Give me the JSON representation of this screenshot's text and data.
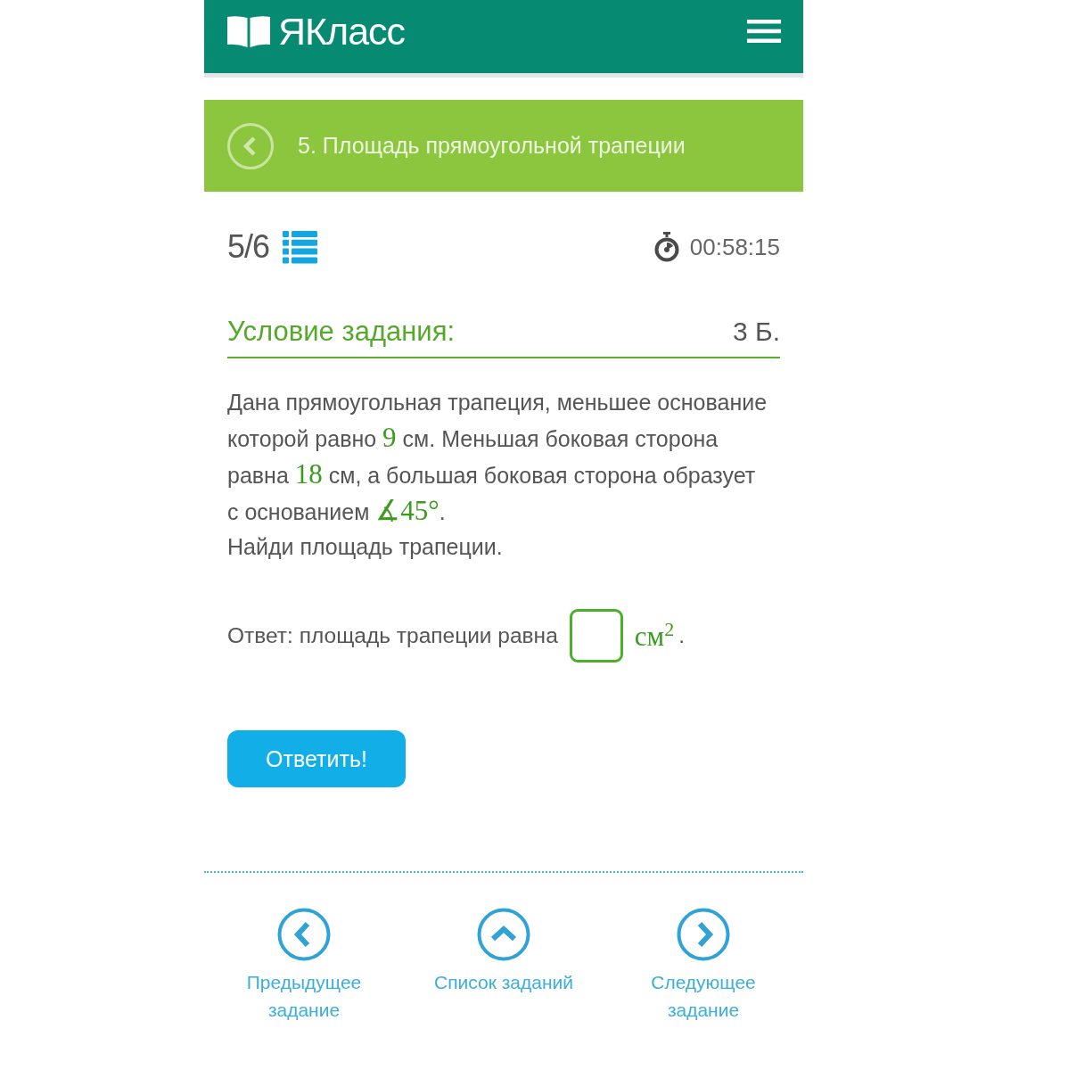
{
  "header": {
    "logo_text": "ЯКласс"
  },
  "topic_bar": {
    "title": "5. Площадь прямоугольной трапеции"
  },
  "progress": {
    "counter": "5/6",
    "timer": "00:58:15"
  },
  "task": {
    "heading": "Условие задания:",
    "points": "3 Б.",
    "problem": [
      {
        "kind": "text",
        "text": "Дана прямоугольная трапеция, меньшее основание которой равно "
      },
      {
        "kind": "math",
        "text": "9"
      },
      {
        "kind": "text",
        "text": " см. Меньшая боковая сторона равна "
      },
      {
        "kind": "math",
        "text": "18"
      },
      {
        "kind": "text",
        "text": " см, а большая боковая сторона образует с основанием "
      },
      {
        "kind": "math",
        "text": "∡45°"
      },
      {
        "kind": "text",
        "text": "."
      }
    ],
    "question": "Найди площадь трапеции.",
    "answer": [
      {
        "kind": "text",
        "text": "Ответ: площадь трапеции равна"
      },
      {
        "kind": "field"
      },
      {
        "kind": "math",
        "text": "см$^{2}$"
      },
      {
        "kind": "text",
        "text": "."
      }
    ]
  },
  "submit_button": "Ответить!",
  "nav": [
    {
      "kind": "previous",
      "label": "Предыдущее задание"
    },
    {
      "kind": "list",
      "label": "Список заданий"
    },
    {
      "kind": "next",
      "label": "Следующее задание"
    }
  ]
}
